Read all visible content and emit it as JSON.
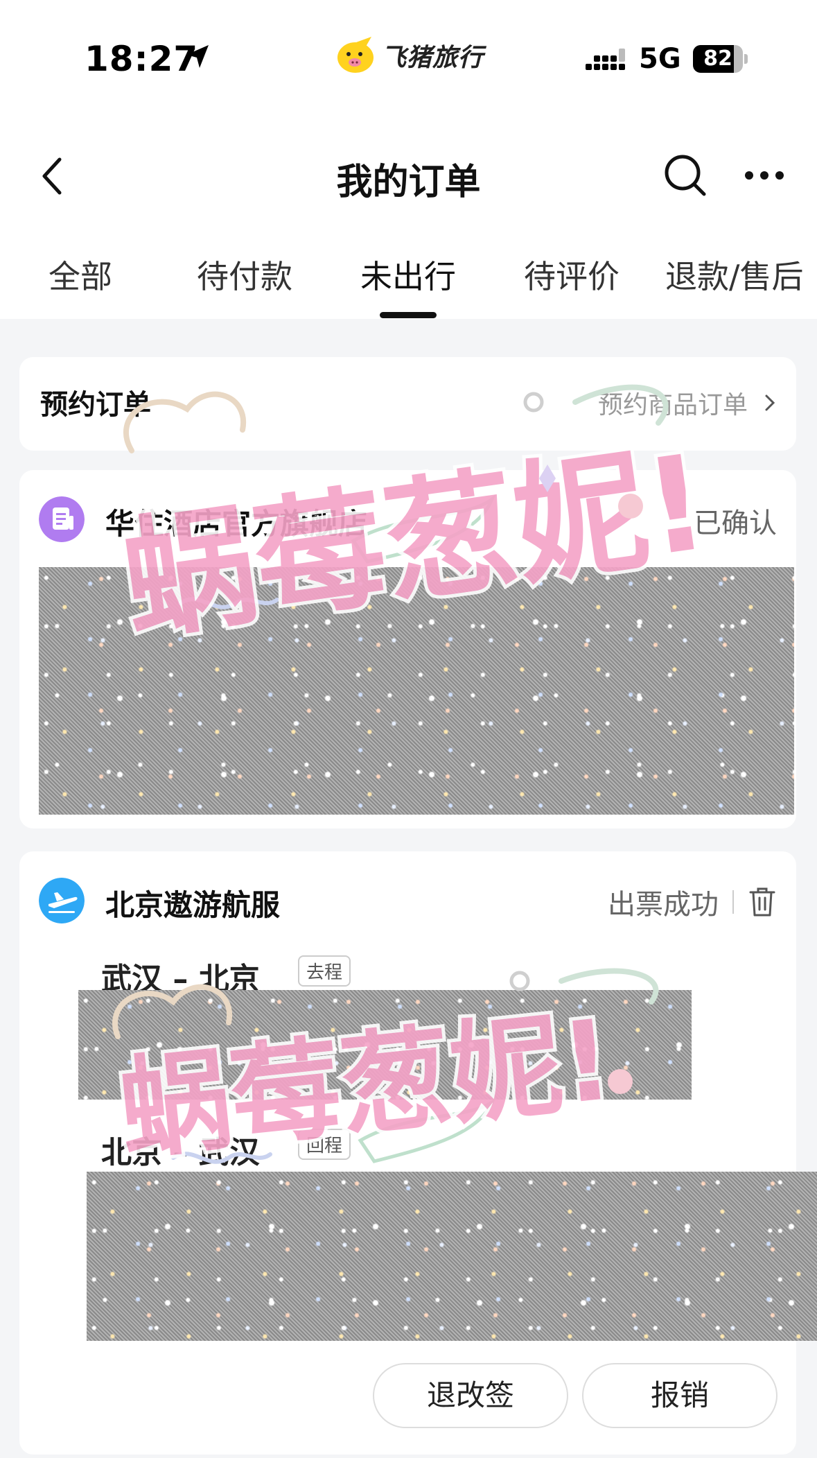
{
  "status_bar": {
    "time": "18:27",
    "brand_name": "飞猪旅行",
    "network": "5G",
    "battery": 82,
    "battery_label": "82"
  },
  "nav": {
    "title": "我的订单"
  },
  "tabs": [
    {
      "label": "全部",
      "active": false
    },
    {
      "label": "待付款",
      "active": false
    },
    {
      "label": "未出行",
      "active": true
    },
    {
      "label": "待评价",
      "active": false
    },
    {
      "label": "退款/售后",
      "active": false
    }
  ],
  "reserve": {
    "title": "预约订单",
    "link": "预约商品订单"
  },
  "hotel_order": {
    "shop_name": "华住酒店官方旗舰店",
    "status": "已确认"
  },
  "flight_order": {
    "shop_name": "北京遨游航服",
    "status": "出票成功",
    "routes": [
      {
        "route": "武汉 – 北京",
        "tag": "去程"
      },
      {
        "route": "北京 – 武汉",
        "tag": "回程"
      }
    ],
    "buttons": {
      "change": "退改签",
      "expense": "报销"
    }
  },
  "watermark": {
    "text": "蜗莓葱妮!"
  },
  "colors": {
    "hotel_icon": "#b07cf0",
    "flight_icon": "#2ea8f5",
    "watermark_pink": "#f5a3c7"
  }
}
